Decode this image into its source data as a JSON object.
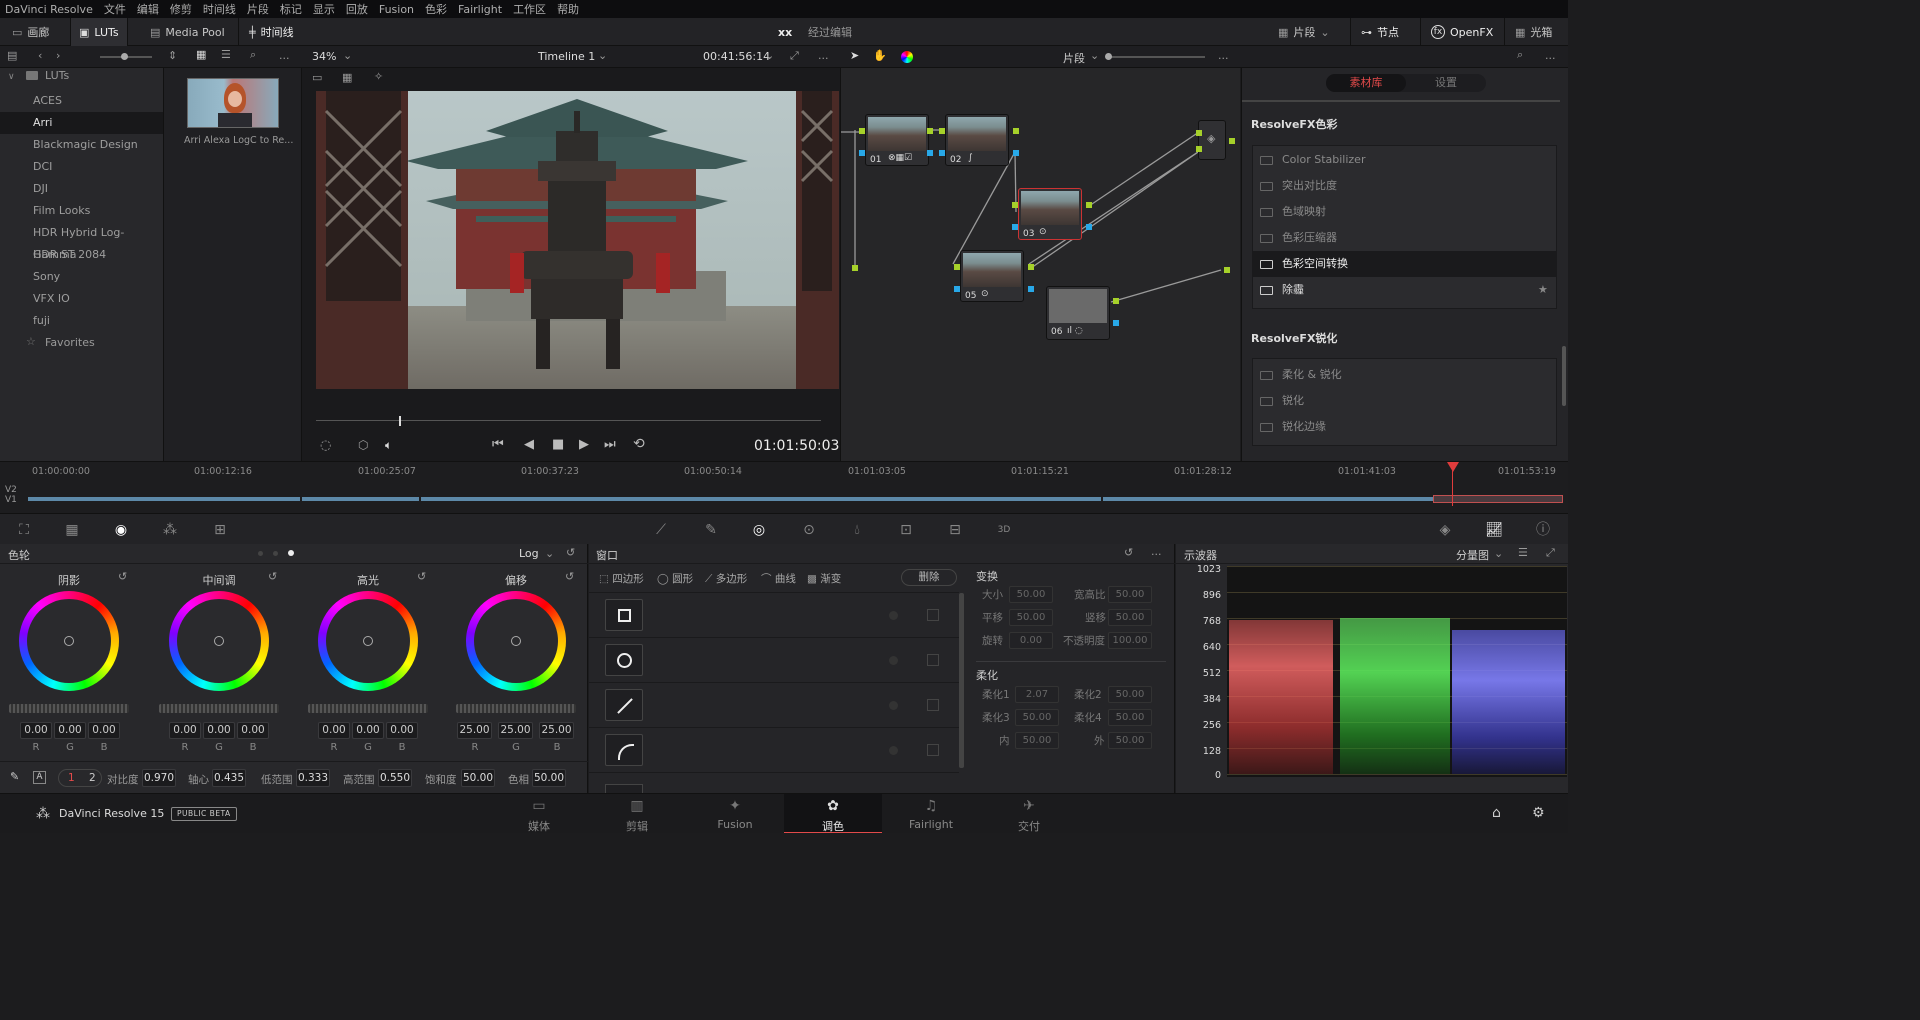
{
  "menu": [
    "DaVinci Resolve",
    "文件",
    "编辑",
    "修剪",
    "时间线",
    "片段",
    "标记",
    "显示",
    "回放",
    "Fusion",
    "色彩",
    "Fairlight",
    "工作区",
    "帮助"
  ],
  "toolbar": {
    "gallery": "画廊",
    "luts": "LUTs",
    "media_pool": "Media Pool",
    "timeline": "时间线",
    "project": "xx",
    "project_status": "经过编辑",
    "clips": "片段",
    "nodes": "节点",
    "openfx": "OpenFX",
    "lightbox": "光箱"
  },
  "subbar": {
    "more": "...",
    "zoom": "34%",
    "timeline_name": "Timeline 1",
    "timecode": "00:41:56:14",
    "node_mode": "片段"
  },
  "luts": {
    "root": "LUTs",
    "items": [
      "ACES",
      "Arri",
      "Blackmagic Design",
      "DCI",
      "DJI",
      "Film Looks",
      "HDR Hybrid Log-Gamma",
      "HDR ST 2084",
      "Sony",
      "VFX IO",
      "fuji"
    ],
    "selected": "Arri",
    "favorites": "Favorites",
    "thumb_label": "Arri Alexa LogC to Re..."
  },
  "viewer": {
    "timecode": "01:01:50:03"
  },
  "nodes": [
    {
      "label": "01"
    },
    {
      "label": "02"
    },
    {
      "label": "03"
    },
    {
      "label": "05"
    },
    {
      "label": "06"
    }
  ],
  "fx": {
    "tab_library": "素材库",
    "tab_settings": "设置",
    "section1": "ResolveFX色彩",
    "section1_items": [
      "Color Stabilizer",
      "突出对比度",
      "色域映射",
      "色彩压缩器",
      "色彩空间转换",
      "除霾"
    ],
    "selected_item": "色彩空间转换",
    "section2": "ResolveFX锐化",
    "section2_items": [
      "柔化 & 锐化",
      "锐化",
      "锐化边缘"
    ]
  },
  "timeline": {
    "ticks": [
      "01:00:00:00",
      "01:00:12:16",
      "01:00:25:07",
      "01:00:37:23",
      "01:00:50:14",
      "01:01:03:05",
      "01:01:15:21",
      "01:01:28:12",
      "01:01:41:03",
      "01:01:53:19"
    ],
    "track_v2": "V2",
    "track_v1": "V1"
  },
  "wheels": {
    "title": "色轮",
    "mode": "Log",
    "wheels": [
      {
        "name": "阴影",
        "r": "0.00",
        "g": "0.00",
        "b": "0.00"
      },
      {
        "name": "中间调",
        "r": "0.00",
        "g": "0.00",
        "b": "0.00"
      },
      {
        "name": "高光",
        "r": "0.00",
        "g": "0.00",
        "b": "0.00"
      },
      {
        "name": "偏移",
        "r": "25.00",
        "g": "25.00",
        "b": "25.00"
      }
    ],
    "rgb_labels": [
      "R",
      "G",
      "B"
    ],
    "page1": "1",
    "page2": "2",
    "contrast_label": "对比度",
    "contrast": "0.970",
    "pivot_label": "轴心",
    "pivot": "0.435",
    "lowrange_label": "低范围",
    "lowrange": "0.333",
    "highrange_label": "高范围",
    "highrange": "0.550",
    "sat_label": "饱和度",
    "sat": "50.00",
    "hue_label": "色相",
    "hue": "50.00"
  },
  "window": {
    "title": "窗口",
    "tools": [
      "四边形",
      "圆形",
      "多边形",
      "曲线",
      "渐变"
    ],
    "delete": "删除",
    "transform_title": "变换",
    "transform": [
      {
        "label": "大小",
        "value": "50.00"
      },
      {
        "label": "宽高比",
        "value": "50.00"
      },
      {
        "label": "平移",
        "value": "50.00"
      },
      {
        "label": "竖移",
        "value": "50.00"
      },
      {
        "label": "旋转",
        "value": "0.00"
      },
      {
        "label": "不透明度",
        "value": "100.00"
      }
    ],
    "soft_title": "柔化",
    "soft": [
      {
        "label": "柔化1",
        "value": "2.07"
      },
      {
        "label": "柔化2",
        "value": "50.00"
      },
      {
        "label": "柔化3",
        "value": "50.00"
      },
      {
        "label": "柔化4",
        "value": "50.00"
      },
      {
        "label": "内",
        "value": "50.00"
      },
      {
        "label": "外",
        "value": "50.00"
      }
    ]
  },
  "scope": {
    "title": "示波器",
    "mode": "分量图",
    "levels": [
      "1023",
      "896",
      "768",
      "640",
      "512",
      "384",
      "256",
      "128",
      "0"
    ]
  },
  "bottom": {
    "app": "DaVinci Resolve 15",
    "beta": "PUBLIC BETA",
    "nav": [
      "媒体",
      "剪辑",
      "Fusion",
      "调色",
      "Fairlight",
      "交付"
    ],
    "active": "调色"
  }
}
